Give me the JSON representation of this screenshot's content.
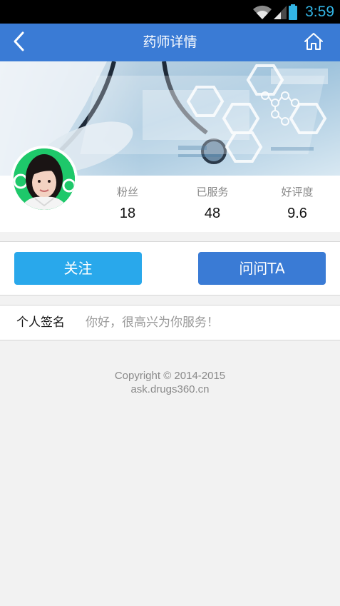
{
  "status_bar": {
    "time": "3:59",
    "icons": [
      "wifi-icon",
      "signal-icon",
      "battery-icon"
    ],
    "accent_color": "#33b5e5"
  },
  "header": {
    "title": "药师详情",
    "back_icon": "chevron-left-icon",
    "home_icon": "home-icon",
    "color": "#3a7bd5"
  },
  "profile": {
    "avatar": "avatar",
    "stats": [
      {
        "label": "粉丝",
        "value": "18"
      },
      {
        "label": "已服务",
        "value": "48"
      },
      {
        "label": "好评度",
        "value": "9.6"
      }
    ]
  },
  "actions": {
    "follow_label": "关注",
    "ask_label": "问问TA",
    "follow_color": "#29a8eb",
    "ask_color": "#3a7bd5"
  },
  "signature": {
    "label": "个人签名",
    "text": "你好，很高兴为你服务！"
  },
  "footer": {
    "copyright": "Copyright © 2014-2015",
    "site": "ask.drugs360.cn"
  }
}
